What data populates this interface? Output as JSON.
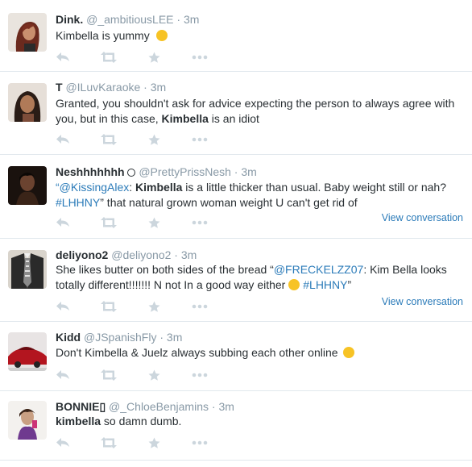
{
  "tweets": [
    {
      "name": "Dink.",
      "handle": "@_ambitiousLEE",
      "sep": "·",
      "time": "3m",
      "text_a": "Kimbella is yummy",
      "avatar_icon": "woman-red-hair-avatar"
    },
    {
      "name": "T",
      "handle": "@ILuvKaraoke",
      "sep": "·",
      "time": "3m",
      "line1": "Granted, you shouldn't ask for advice expecting the person to always agree with",
      "line2_pre": "you, but in this case, ",
      "line2_kw": "Kimbella",
      "line2_post": " is an idiot",
      "avatar_icon": "woman-long-hair-avatar"
    },
    {
      "name": "Neshhhhhhh",
      "handle": "@PrettyPrissNesh",
      "sep": "·",
      "time": "3m",
      "q_open": "“",
      "mention": "@KissingAlex",
      "colon": ": ",
      "kw": "Kimbella",
      "line1_rest": " is a little thicker than usual. Baby weight still or nah?",
      "hashtag": "#LHHNY",
      "line2_rest": "” that natural grown woman weight U can't get rid of",
      "view": "View conversation",
      "avatar_icon": "dark-portrait-avatar"
    },
    {
      "name": "deliyono2",
      "handle": "@deliyono2",
      "sep": "·",
      "time": "3m",
      "line1_pre": "She likes butter on both sides of the bread “",
      "mention": "@FRECKELZZ07",
      "line1_post": ": Kim Bella looks",
      "line2_pre": "totally different!!!!!!! N not In a good way either ",
      "hashtag": "#LHHNY",
      "line2_post": "”",
      "view": "View conversation",
      "avatar_icon": "suit-tie-avatar"
    },
    {
      "name": "Kidd",
      "handle": "@JSpanishFly",
      "sep": "·",
      "time": "3m",
      "text_a": "Don't Kimbella & Juelz always subbing each other online",
      "avatar_icon": "red-car-avatar"
    },
    {
      "name": "BONNIE▯",
      "handle": "@_ChloeBenjamins",
      "sep": "·",
      "time": "3m",
      "kw": "kimbella",
      "text_rest": " so damn dumb.",
      "avatar_icon": "selfie-avatar"
    }
  ],
  "actions": [
    "reply-icon",
    "retweet-icon",
    "favorite-icon",
    "more-icon"
  ],
  "colors": {
    "name": "#292f33",
    "meta": "#8899a6",
    "link": "#2b7bb9",
    "action_icon": "#ccd6dd",
    "divider": "#e1e8ed"
  }
}
